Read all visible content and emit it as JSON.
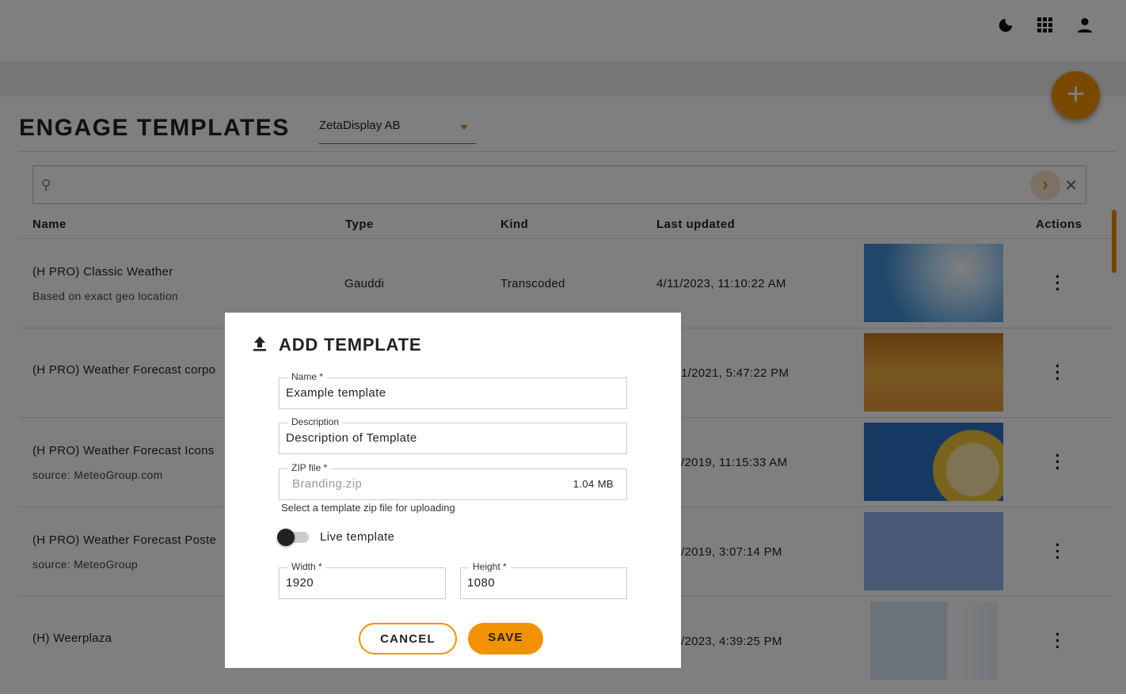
{
  "header": {
    "icons": [
      "moon-icon",
      "apps-grid-icon",
      "user-icon"
    ]
  },
  "page": {
    "title": "ENGAGE TEMPLATES",
    "organization": "ZetaDisplay AB",
    "add_icon": "plus-icon"
  },
  "search": {
    "placeholder": "",
    "value": ""
  },
  "table": {
    "columns": [
      "Name",
      "Type",
      "Kind",
      "Last updated",
      "Actions"
    ],
    "rows": [
      {
        "name": "(H PRO) Classic Weather",
        "description": "Based on exact geo location",
        "type": "Gauddi",
        "kind": "Transcoded",
        "updated": "4/11/2023, 11:10:22 AM"
      },
      {
        "name": "(H PRO) Weather Forecast corpo",
        "description": "",
        "type": "",
        "kind": "",
        "updated": "1/2021, 5:47:22 PM"
      },
      {
        "name": "(H PRO) Weather Forecast Icons",
        "description": "source: MeteoGroup.com",
        "type": "",
        "kind": "",
        "updated": "/2019, 11:15:33 AM"
      },
      {
        "name": "(H PRO) Weather Forecast Poste",
        "description": "source: MeteoGroup",
        "type": "",
        "kind": "",
        "updated": "/2019, 3:07:14 PM"
      },
      {
        "name": "(H) Weerplaza",
        "description": "",
        "type": "",
        "kind": "",
        "updated": "/2023, 4:39:25 PM"
      }
    ]
  },
  "modal": {
    "title": "ADD TEMPLATE",
    "icon": "upload-icon",
    "name_label": "Name *",
    "name_value": "Example template",
    "description_label": "Description",
    "description_value": "Description of Template",
    "zip_label": "ZIP file *",
    "zip_value": "Branding.zip",
    "zip_size": "1.04 MB",
    "zip_helper": "Select a template zip file for uploading",
    "live_label": "Live template",
    "live_enabled": false,
    "width_label": "Width *",
    "width_value": "1920",
    "height_label": "Height *",
    "height_value": "1080",
    "cancel": "CANCEL",
    "save": "SAVE"
  },
  "colors": {
    "accent": "#f39200"
  }
}
